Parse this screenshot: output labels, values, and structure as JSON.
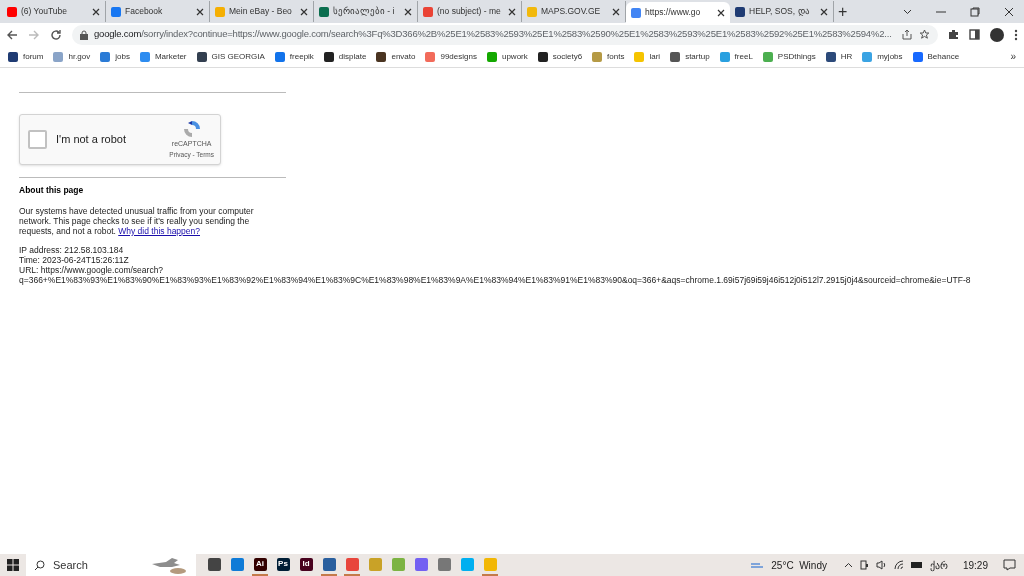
{
  "tabs": [
    {
      "title": "(6) YouTube",
      "color": "#ff0000",
      "selected": false
    },
    {
      "title": "Facebook",
      "color": "#1877f2",
      "selected": false
    },
    {
      "title": "Mein eBay - Beo",
      "color": "#f5af02",
      "selected": false
    },
    {
      "title": "სერიალები - i",
      "color": "#0b6e4f",
      "selected": false
    },
    {
      "title": "(no subject) - me",
      "color": "#ea4335",
      "selected": false
    },
    {
      "title": "MAPS.GOV.GE",
      "color": "#f2b90c",
      "selected": false
    },
    {
      "title": "https://www.go",
      "color": "#4285f4",
      "selected": true
    },
    {
      "title": "HELP, SOS, და",
      "color": "#1f3b73",
      "selected": false
    }
  ],
  "new_tab": "+",
  "address": {
    "host": "google.com",
    "path": "/sorry/index?continue=https://www.google.com/search%3Fq%3D366%2B%25E1%2583%2593%25E1%2583%2590%25E1%2583%2593%25E1%2583%2592%25E1%2583%2594%2..."
  },
  "bookmarks": [
    {
      "label": "forum",
      "color": "#1f3b73"
    },
    {
      "label": "hr.gov",
      "color": "#8aa4c8"
    },
    {
      "label": "jobs",
      "color": "#2b7bd6"
    },
    {
      "label": "Marketer",
      "color": "#2d8cf0"
    },
    {
      "label": "GIS GEORGIA",
      "color": "#333f50"
    },
    {
      "label": "freepik",
      "color": "#1273eb"
    },
    {
      "label": "displate",
      "color": "#222222"
    },
    {
      "label": "envato",
      "color": "#4a3421"
    },
    {
      "label": "99designs",
      "color": "#f26b5b"
    },
    {
      "label": "upwork",
      "color": "#14a800"
    },
    {
      "label": "society6",
      "color": "#222222"
    },
    {
      "label": "fonts",
      "color": "#b59a45"
    },
    {
      "label": "lari",
      "color": "#f5c400"
    },
    {
      "label": "startup",
      "color": "#555555"
    },
    {
      "label": "freeL",
      "color": "#29a0e0"
    },
    {
      "label": "PSDthings",
      "color": "#4caf50"
    },
    {
      "label": "HR",
      "color": "#2c4a7a"
    },
    {
      "label": "myjobs",
      "color": "#3aa3e3"
    },
    {
      "label": "Behance",
      "color": "#1769ff"
    }
  ],
  "more_bookmarks": "»",
  "captcha": {
    "label": "I'm not a robot",
    "checked": false,
    "brand": "reCAPTCHA",
    "links": "Privacy - Terms"
  },
  "about": {
    "heading": "About this page",
    "text": "Our systems have detected unusual traffic from your computer network. This page checks to see if it's really you sending the requests, and not a robot.",
    "link": "Why did this happen?"
  },
  "details": [
    "IP address: 212.58.103.184",
    "Time: 2023-06-24T15:26:11Z",
    "URL: https://www.google.com/search?"
  ],
  "url_query": "q=366+%E1%83%93%E1%83%90%E1%83%93%E1%83%92%E1%83%94%E1%83%9C%E1%83%98%E1%83%9A%E1%83%94%E1%83%91%E1%83%90&oq=366+&aqs=chrome.1.69i57j69i59j46i512j0i512l7.2915j0j4&sourceid=chrome&ie=UTF-8",
  "taskbar": {
    "search_placeholder": "Search",
    "apps": [
      {
        "color": "#444444",
        "active": false
      },
      {
        "color": "#0f7bd7",
        "active": false
      },
      {
        "label": "Ai",
        "color": "#330000",
        "active": true
      },
      {
        "label": "Ps",
        "color": "#001e36",
        "active": false
      },
      {
        "label": "Id",
        "color": "#49021f",
        "active": false
      },
      {
        "color": "#2a5f9e",
        "active": true
      },
      {
        "color": "#e8453c",
        "active": true
      },
      {
        "color": "#c9a227",
        "active": false
      },
      {
        "color": "#7cb342",
        "active": false
      },
      {
        "color": "#7360f2",
        "active": false
      },
      {
        "color": "#777777",
        "active": false
      },
      {
        "color": "#00aff0",
        "active": false
      },
      {
        "color": "#f2b705",
        "active": true
      }
    ],
    "weather": "25°C  Windy",
    "language": "ქარ",
    "time": "19:29"
  }
}
